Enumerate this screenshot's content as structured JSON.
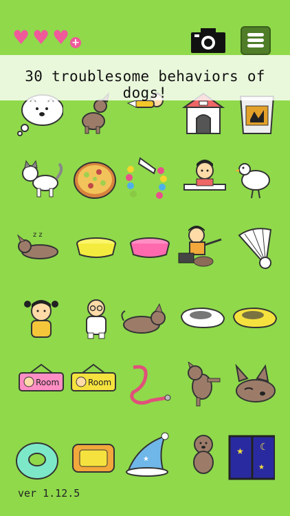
{
  "hud": {
    "hearts": [
      "heart-icon",
      "heart-icon",
      "heart-icon"
    ],
    "heart_plus": "+",
    "camera_icon": "camera-icon",
    "menu_icon": "hamburger-menu-icon"
  },
  "banner": {
    "text": "30 troublesome behaviors of dogs!"
  },
  "grid": {
    "rows": [
      [
        "thought-bubble-dog-face",
        "dog-rolling-on-back",
        "kid-flying",
        "dog-house",
        "dog-food-bag"
      ],
      [
        "cat",
        "pizza",
        "balloon-arch",
        "kid-at-table",
        "white-bird"
      ],
      [
        "sleeping-dog",
        "yellow-food-bowl",
        "pink-food-bowl",
        "kid-pointing",
        "shuttlecock"
      ],
      [
        "little-girl",
        "man-in-glasses",
        "dog-lying-down",
        "white-shoe",
        "yellow-shoe"
      ],
      [
        "pink-room-sign",
        "yellow-room-sign",
        "pink-leash",
        "dog-scratching",
        "dog-head-resting"
      ],
      [
        "teal-donut-toy",
        "orange-pet-bed",
        "blue-star-hat",
        "sitting-dog",
        "night-window"
      ]
    ]
  },
  "signs": {
    "room_label": "Room"
  },
  "footer": {
    "version": "ver 1.12.5"
  }
}
